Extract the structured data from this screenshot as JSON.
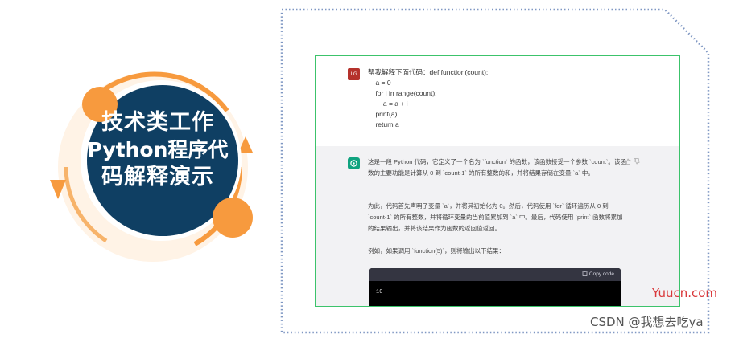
{
  "badge": {
    "line1": "技术类工作",
    "line2": "Python程序代",
    "line3": "码解释演示"
  },
  "chat": {
    "user_avatar": "LG",
    "user_message": "帮我解释下面代码：def function(count):\n    a = 0\n    for i in range(count):\n        a = a + i\n    print(a)\n    return a",
    "ai_paragraphs": [
      "这是一段 Python 代码，它定义了一个名为 `function` 的函数，该函数接受一个参数 `count`。该函数的主要功能是计算从 0 到 `count-1` 的所有整数的和，并将结果存储在变量 `a` 中。",
      "为此，代码首先声明了变量 `a`，并将其初始化为 0。然后，代码使用 `for` 循环遍历从 0 到 `count-1` 的所有整数，并将循环变量的当前值累加到 `a` 中。最后，代码使用 `print` 函数将累加的结果输出，并将该结果作为函数的返回值返回。",
      "例如，如果调用 `function(5)`，则将输出以下结果："
    ],
    "copy_label": "Copy code",
    "code_output": "10",
    "icons": [
      "thumbs-up-icon",
      "thumbs-down-icon",
      "clipboard-icon",
      "openai-logo-icon"
    ]
  },
  "watermarks": {
    "site": "Yuucn.com",
    "csdn": "CSDN @我想去吃ya"
  },
  "colors": {
    "badge_navy": "#0f3f63",
    "badge_orange": "#f79a3e",
    "panel_border": "#3cc36b",
    "ai_avatar": "#10a37f",
    "user_avatar": "#b5322c"
  }
}
